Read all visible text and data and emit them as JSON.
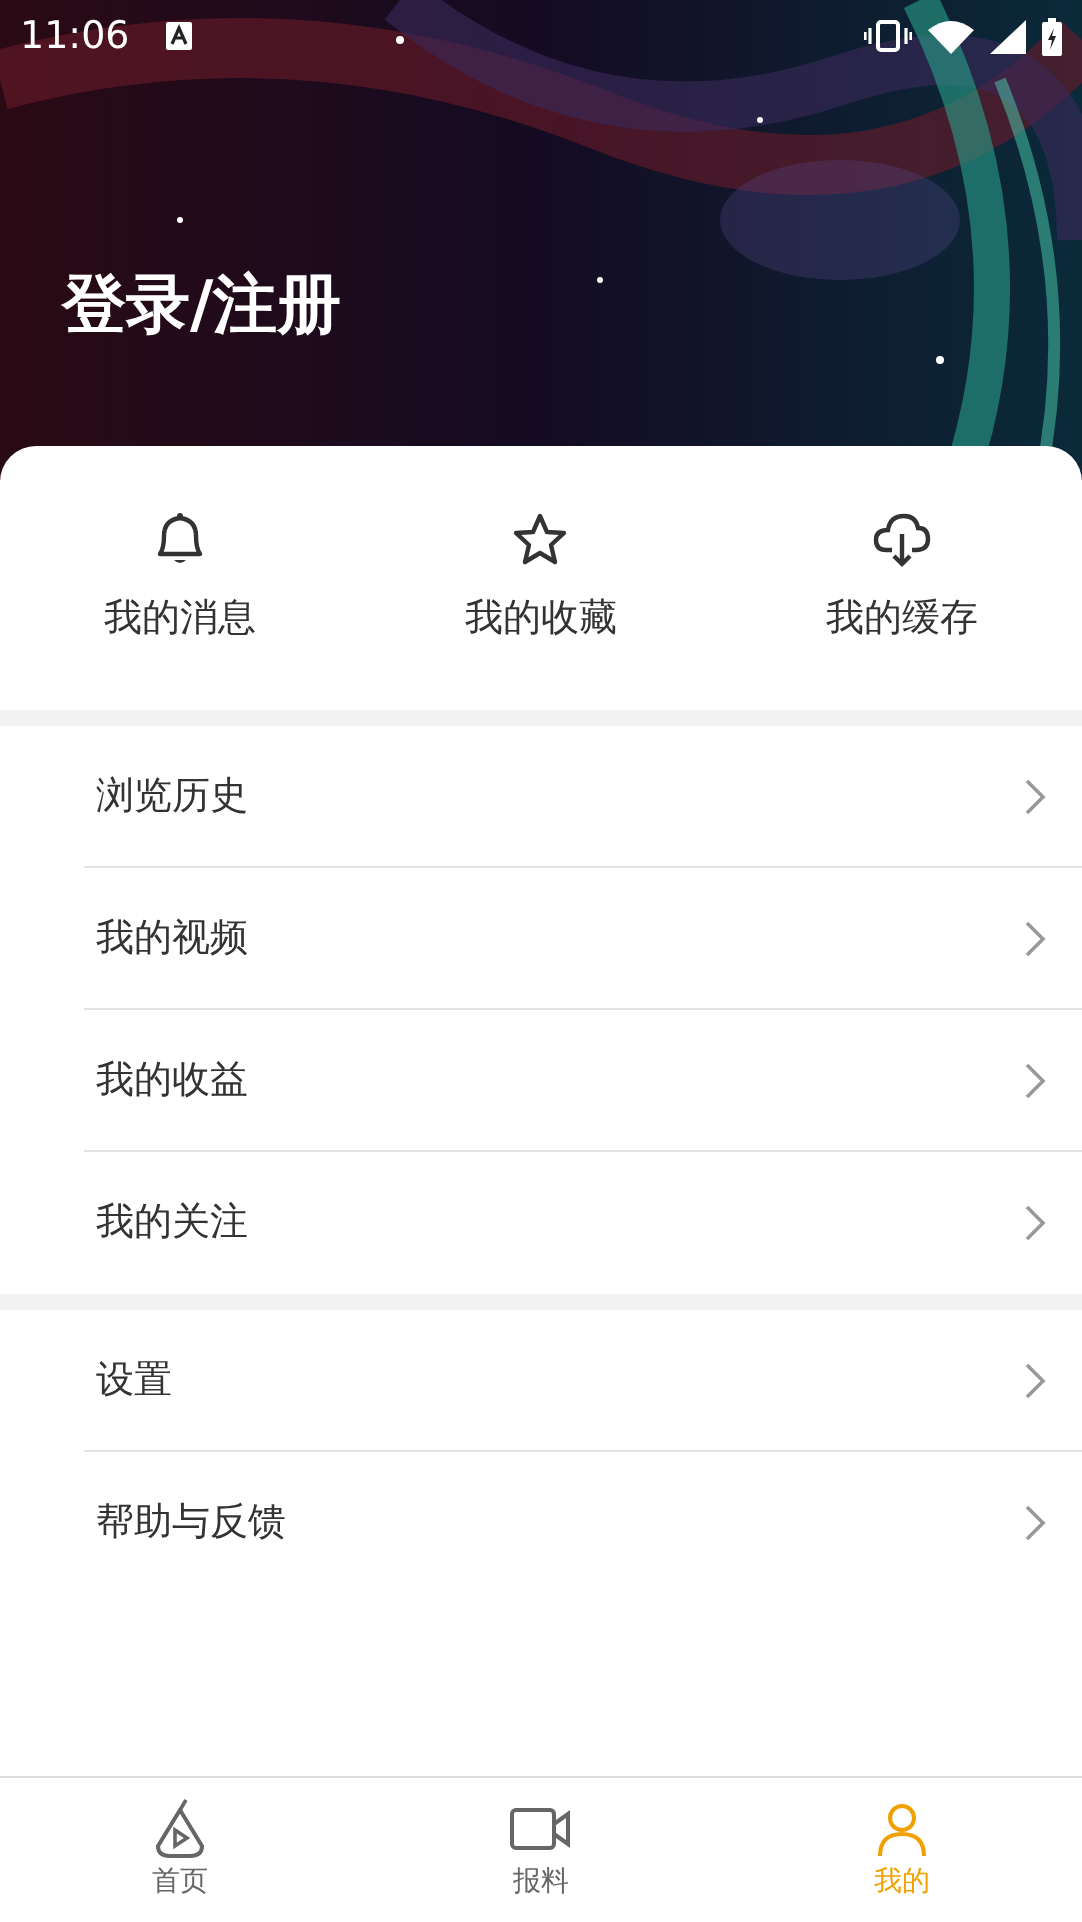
{
  "status_bar": {
    "time": "11:06"
  },
  "header": {
    "title": "登录/注册"
  },
  "quick_actions": [
    {
      "kind": "bell",
      "label": "我的消息"
    },
    {
      "kind": "star",
      "label": "我的收藏"
    },
    {
      "kind": "cloud",
      "label": "我的缓存"
    }
  ],
  "menu_groups": [
    [
      {
        "label": "浏览历史"
      },
      {
        "label": "我的视频"
      },
      {
        "label": "我的收益"
      },
      {
        "label": "我的关注"
      }
    ],
    [
      {
        "label": "设置"
      },
      {
        "label": "帮助与反馈"
      }
    ]
  ],
  "tab_bar": [
    {
      "kind": "home",
      "label": "首页",
      "selected": false
    },
    {
      "kind": "video",
      "label": "报料",
      "selected": false
    },
    {
      "kind": "user",
      "label": "我的",
      "selected": true
    }
  ]
}
